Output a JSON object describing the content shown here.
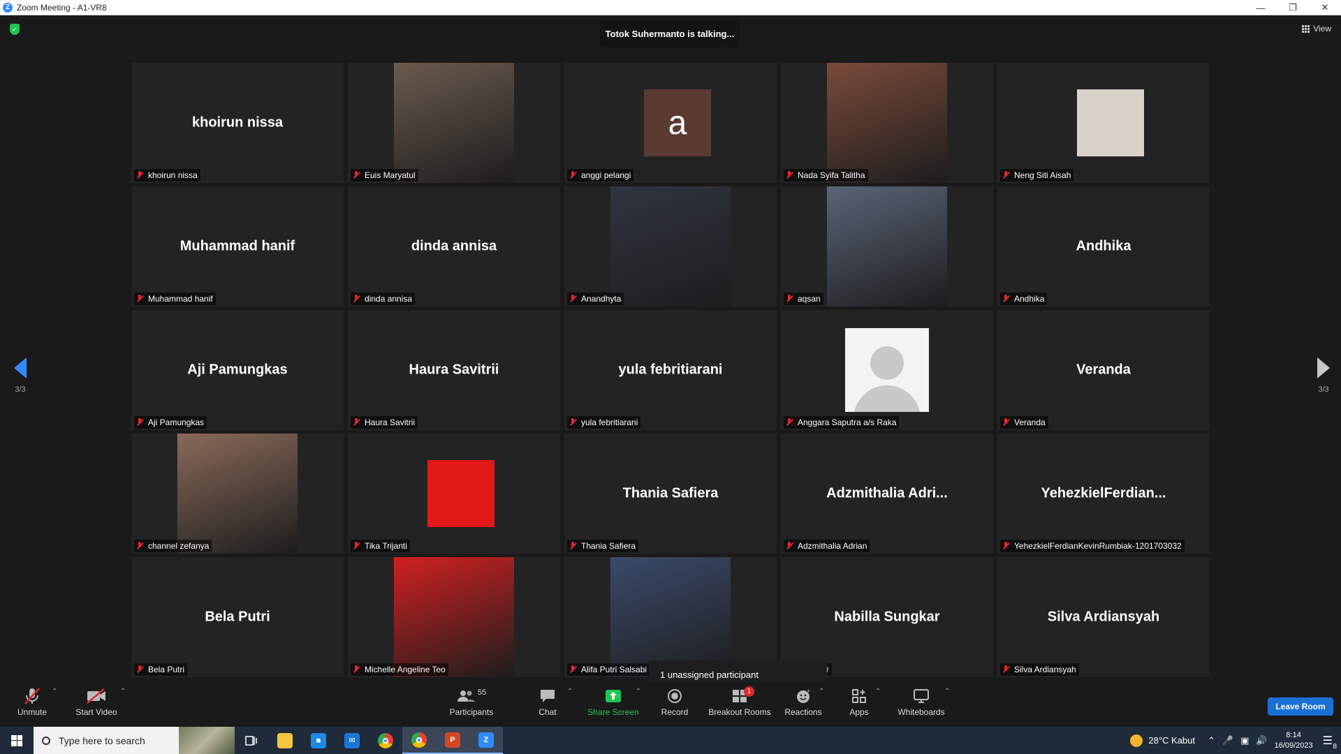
{
  "window": {
    "title": "Zoom Meeting - A1-VR8",
    "app_icon_letter": "Z"
  },
  "notice": {
    "talking": "Totok Suhermanto is talking..."
  },
  "view_button": {
    "label": "View"
  },
  "pagination": {
    "left": "3/3",
    "right": "3/3"
  },
  "tiles": [
    {
      "name": "khoirun nissa",
      "display": "khoirun nissa",
      "kind": "name"
    },
    {
      "name": "Euis Maryatul",
      "display": "",
      "kind": "photo",
      "photo_color": "#6b5a4e"
    },
    {
      "name": "anggi pelangi",
      "display": "a",
      "kind": "letter"
    },
    {
      "name": "Nada Syifa Talitha",
      "display": "",
      "kind": "photo",
      "photo_color": "#7a4a3a"
    },
    {
      "name": "Neng Siti Aisah",
      "display": "",
      "kind": "smallphoto",
      "photo_color": "#d9d2c8"
    },
    {
      "name": "Muhammad hanif",
      "display": "Muhammad hanif",
      "kind": "name"
    },
    {
      "name": "dinda annisa",
      "display": "dinda annisa",
      "kind": "name"
    },
    {
      "name": "Anandhyta",
      "display": "",
      "kind": "photo",
      "photo_color": "#2f3440"
    },
    {
      "name": "aqsan",
      "display": "",
      "kind": "photo",
      "photo_color": "#5a6478"
    },
    {
      "name": "Andhika",
      "display": "Andhika",
      "kind": "name"
    },
    {
      "name": "Aji Pamungkas",
      "display": "Aji Pamungkas",
      "kind": "name"
    },
    {
      "name": "Haura Savitrii",
      "display": "Haura Savitrii",
      "kind": "name"
    },
    {
      "name": "yula febritiarani",
      "display": "yula febritiarani",
      "kind": "name"
    },
    {
      "name": "Anggara Saputra a/s Raka",
      "display": "",
      "kind": "default"
    },
    {
      "name": "Veranda",
      "display": "Veranda",
      "kind": "name"
    },
    {
      "name": "channel zefanya",
      "display": "",
      "kind": "photo",
      "photo_color": "#8a6a5a"
    },
    {
      "name": "Tika Trijanti",
      "display": "",
      "kind": "smallphoto",
      "photo_color": "#e01818"
    },
    {
      "name": "Thania Safiera",
      "display": "Thania Safiera",
      "kind": "name"
    },
    {
      "name": "Adzmithalia Adrian",
      "display": "Adzmithalia  Adri...",
      "kind": "name"
    },
    {
      "name": "YehezkielFerdianKevinRumbiak-1201703032",
      "display": "YehezkielFerdian...",
      "kind": "name"
    },
    {
      "name": "Bela Putri",
      "display": "Bela Putri",
      "kind": "name"
    },
    {
      "name": "Michelle Angeline Teo",
      "display": "",
      "kind": "photo",
      "photo_color": "#d02020"
    },
    {
      "name": "Alifa Putri Salsabi",
      "display": "",
      "kind": "photo",
      "photo_color": "#3b4a6a"
    },
    {
      "name": "Sungkar",
      "display": "Nabilla Sungkar",
      "kind": "name"
    },
    {
      "name": "Silva Ardiansyah",
      "display": "Silva Ardiansyah",
      "kind": "name"
    }
  ],
  "tooltip": {
    "text": "1 unassigned participant"
  },
  "toolbar": {
    "unmute": "Unmute",
    "start_video": "Start Video",
    "participants": "Participants",
    "participants_count": "55",
    "chat": "Chat",
    "share_screen": "Share Screen",
    "record": "Record",
    "breakout_rooms": "Breakout Rooms",
    "breakout_badge": "1",
    "reactions": "Reactions",
    "apps": "Apps",
    "whiteboards": "Whiteboards",
    "leave": "Leave Room"
  },
  "taskbar": {
    "search_placeholder": "Type here to search",
    "weather": "28°C  Kabut",
    "time": "8:14",
    "date": "16/09/2023",
    "notification_count": "8"
  },
  "colors": {
    "accent": "#2d8cff",
    "share_green": "#23c552",
    "muted_red": "#e02828",
    "leave_blue": "#1a6fd6"
  }
}
